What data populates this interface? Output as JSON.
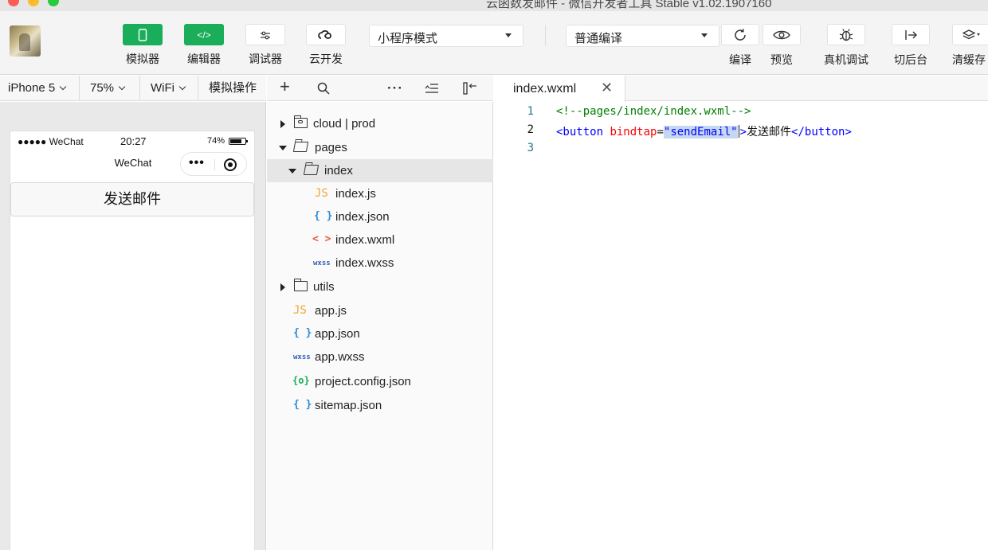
{
  "window": {
    "title": "云函数发邮件 - 微信开发者工具 Stable v1.02.1907160"
  },
  "toolbar": {
    "left_buttons": [
      {
        "label": "模拟器",
        "icon": "phone-icon",
        "active": true
      },
      {
        "label": "编辑器",
        "icon": "code-icon",
        "active": true
      },
      {
        "label": "调试器",
        "icon": "debug-toggle-icon",
        "active": false
      },
      {
        "label": "云开发",
        "icon": "cloud-link-icon",
        "active": false
      }
    ],
    "mode_select": "小程序模式",
    "compile_select": "普通编译",
    "right_buttons": [
      {
        "label": "编译",
        "icon": "refresh-icon"
      },
      {
        "label": "预览",
        "icon": "eye-icon"
      },
      {
        "label": "真机调试",
        "icon": "bug-icon"
      },
      {
        "label": "切后台",
        "icon": "switch-background-icon"
      },
      {
        "label": "清缓存",
        "icon": "layers-icon"
      }
    ]
  },
  "simulator": {
    "device": "iPhone 5",
    "zoom": "75%",
    "network": "WiFi",
    "operation": "模拟操作",
    "status_bar": {
      "carrier": "●●●●● WeChat",
      "time": "20:27",
      "battery_percent": "74%"
    },
    "nav_title": "WeChat",
    "page_button": "发送邮件"
  },
  "file_tree": {
    "items": [
      {
        "label": "cloud | prod",
        "type": "cloud-folder"
      },
      {
        "label": "pages",
        "type": "folder-open"
      },
      {
        "label": "index",
        "type": "folder-open"
      },
      {
        "label": "index.js",
        "type": "js",
        "icon_text": "JS"
      },
      {
        "label": "index.json",
        "type": "json",
        "icon_text": "{ }"
      },
      {
        "label": "index.wxml",
        "type": "wxml",
        "icon_text": "< >"
      },
      {
        "label": "index.wxss",
        "type": "wxss",
        "icon_text": "wxss"
      },
      {
        "label": "utils",
        "type": "folder"
      },
      {
        "label": "app.js",
        "type": "js",
        "icon_text": "JS"
      },
      {
        "label": "app.json",
        "type": "json",
        "icon_text": "{ }"
      },
      {
        "label": "app.wxss",
        "type": "wxss",
        "icon_text": "wxss"
      },
      {
        "label": "project.config.json",
        "type": "config",
        "icon_text": "{o}"
      },
      {
        "label": "sitemap.json",
        "type": "json",
        "icon_text": "{ }"
      }
    ]
  },
  "editor": {
    "tab_name": "index.wxml",
    "lines": [
      {
        "number": "1",
        "comment": "<!--pages/index/index.wxml-->"
      },
      {
        "number": "2",
        "open_tag": "<button",
        "attr_name": " bindtap",
        "equals": "=",
        "attr_value": "\"sendEmail\"",
        "close_bracket": ">",
        "text": "发送邮件",
        "end_tag": "</button>"
      },
      {
        "number": "3"
      }
    ]
  }
}
